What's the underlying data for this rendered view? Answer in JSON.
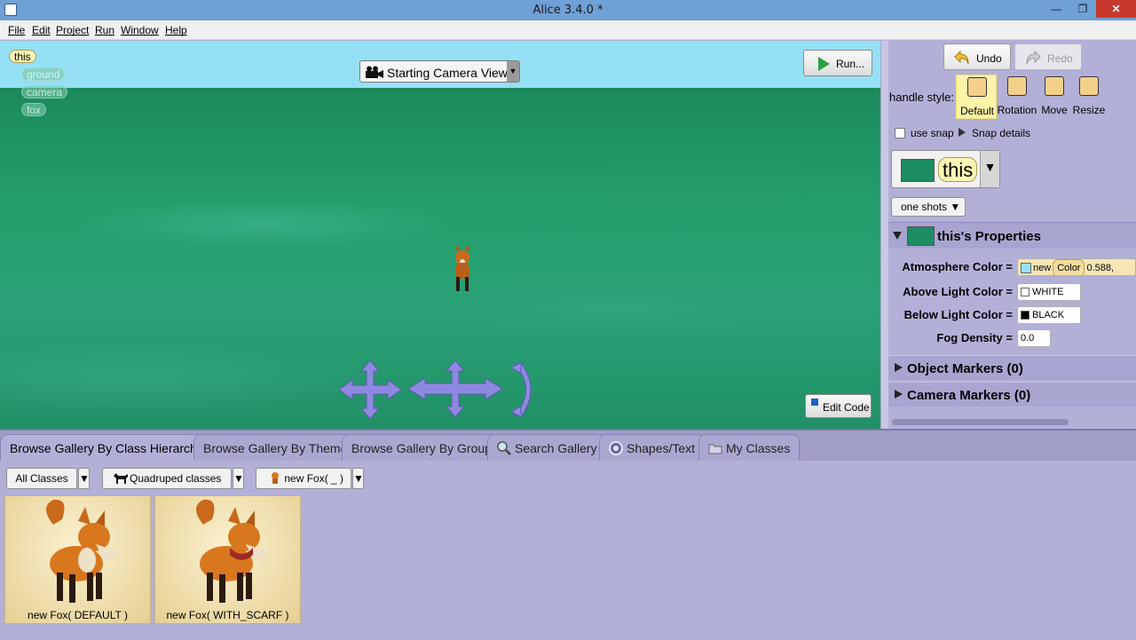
{
  "window": {
    "title": "Alice 3.4.0  *",
    "min_glyph": "—",
    "max_glyph": "❐",
    "close_glyph": "✕"
  },
  "menubar": {
    "items": [
      "File",
      "Edit",
      "Project",
      "Run",
      "Window",
      "Help"
    ]
  },
  "scene": {
    "tags": [
      "this",
      "ground",
      "camera",
      "fox"
    ],
    "camera_view": "Starting Camera View",
    "run_label": "Run...",
    "edit_code_label": "Edit Code",
    "sky_color": "#96e0f5",
    "ground_color": "#23a06c"
  },
  "toolbar": {
    "undo_label": "Undo",
    "redo_label": "Redo"
  },
  "handle": {
    "label": "handle style:",
    "styles": [
      "Default",
      "Rotation",
      "Move",
      "Resize"
    ],
    "selected": "Default"
  },
  "snap": {
    "label": "use snap",
    "details_label": "Snap details",
    "checked": false
  },
  "selected_object": {
    "name": "this"
  },
  "one_shots_label": "one shots",
  "properties": {
    "title": "this's Properties",
    "atmosphere_label": "Atmosphere Color =",
    "atmosphere_new": "new",
    "atmosphere_color": "Color",
    "atmosphere_value": "0.588,",
    "above_label": "Above Light Color =",
    "above_value": "WHITE",
    "below_label": "Below Light Color =",
    "below_value": "BLACK",
    "fog_label": "Fog Density =",
    "fog_value": "0.0"
  },
  "markers": {
    "object": "Object Markers (0)",
    "camera": "Camera Markers (0)"
  },
  "gallery_tabs": [
    "Browse Gallery By Class Hierarchy",
    "Browse Gallery By Theme",
    "Browse Gallery By Group",
    "Search Gallery",
    "Shapes/Text",
    "My Classes"
  ],
  "gallery": {
    "crumbs": [
      "All Classes",
      "Quadruped classes",
      "new Fox( _ )"
    ],
    "tiles": [
      "new Fox( DEFAULT )",
      "new Fox( WITH_SCARF )"
    ]
  },
  "colors": {
    "accent_purple": "#b3b0d8",
    "fox_orange": "#d9771e"
  }
}
